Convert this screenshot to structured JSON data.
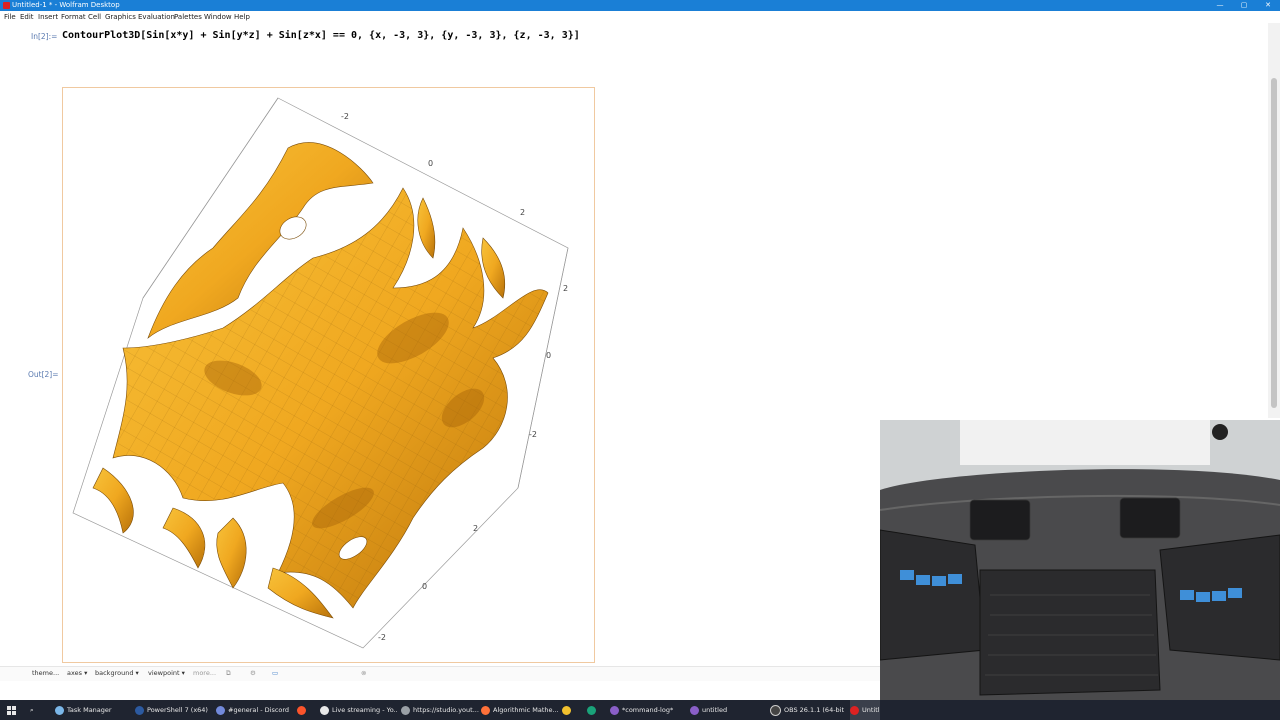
{
  "window": {
    "title": "Untitled-1 * - Wolfram Desktop",
    "controls": [
      "—",
      "▢",
      "✕"
    ]
  },
  "menu": [
    "File",
    "Edit",
    "Insert",
    "Format",
    "Cell",
    "Graphics",
    "Evaluation",
    "Palettes",
    "Window",
    "Help"
  ],
  "notebook": {
    "in_label": "In[2]:=",
    "input": "ContourPlot3D[Sin[x*y] + Sin[y*z] + Sin[z*x] == 0, {x, -3, 3}, {y, -3, 3}, {z, -3, 3}]",
    "out_label": "Out[2]="
  },
  "plot": {
    "surface_color": "#f0a820",
    "box_color": "#9a9a9a",
    "axis_labels": [
      "-2",
      "0",
      "2",
      "2",
      "0",
      "-2",
      "2",
      "0",
      "-2"
    ]
  },
  "toolbar": {
    "items": [
      "theme...",
      "axes ▾",
      "background ▾",
      "viewpoint ▾",
      "more..."
    ]
  },
  "taskbar": {
    "items": [
      "Task Manager",
      "PowerShell 7 (x64)",
      "#general - Discord",
      "Live streaming - Yo...",
      "https://studio.yout...",
      "Algorithmic Mathe...",
      "*command-log*",
      "untitled",
      "OBS 26.1.1 (64-bit,...",
      "Untitl"
    ]
  },
  "colors": {
    "titlebar": "#1a7fd6",
    "accent": "#f0a820",
    "taskbar": "#1f2430"
  }
}
